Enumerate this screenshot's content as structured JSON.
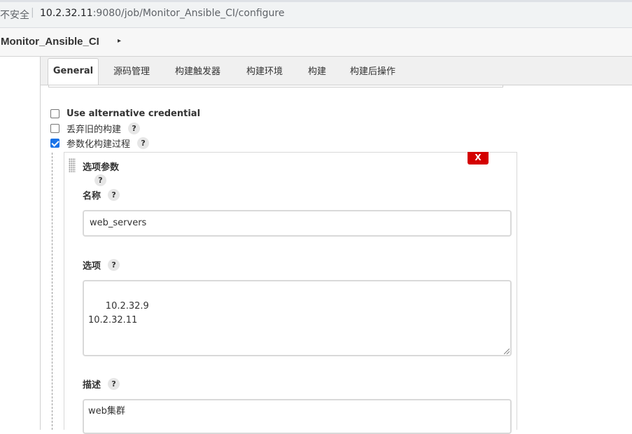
{
  "browser": {
    "insecure_label": "不安全",
    "separator": "|",
    "url_host": "10.2.32.11",
    "url_rest": ":9080/job/Monitor_Ansible_CI/configure"
  },
  "breadcrumb": {
    "title": "Monitor_Ansible_CI",
    "arrow": "▸"
  },
  "tabs": [
    {
      "label": "General"
    },
    {
      "label": "源码管理"
    },
    {
      "label": "构建触发器"
    },
    {
      "label": "构建环境"
    },
    {
      "label": "构建"
    },
    {
      "label": "构建后操作"
    }
  ],
  "options": {
    "alt_credential": {
      "label": "Use alternative credential",
      "checked": false
    },
    "discard_old": {
      "label": "丢弃旧的构建",
      "checked": false,
      "help": "?"
    },
    "parameterized": {
      "label": "参数化构建过程",
      "checked": true,
      "help": "?"
    }
  },
  "choice_param": {
    "title": "选项参数",
    "delete_label": "X",
    "help": "?",
    "name_label": "名称",
    "name_value": "web_servers",
    "choices_label": "选项",
    "choices_value": "10.2.32.9\n10.2.32.11",
    "desc_label": "描述",
    "desc_value": "web集群"
  }
}
